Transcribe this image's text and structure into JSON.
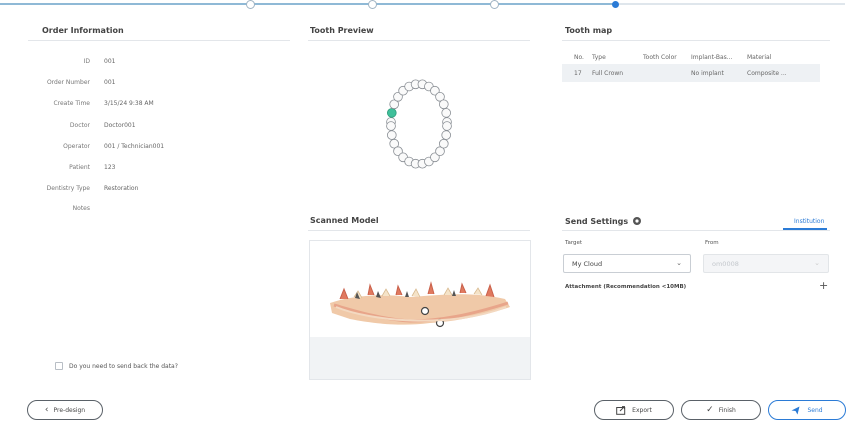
{
  "stepper": {
    "steps": [
      "",
      "",
      "",
      ""
    ],
    "active_index": 3
  },
  "order_info": {
    "title": "Order Information",
    "fields": [
      {
        "label": "ID",
        "value": "001"
      },
      {
        "label": "Order Number",
        "value": "001"
      },
      {
        "label": "Create Time",
        "value": "3/15/24 9:38 AM"
      },
      {
        "label": "Doctor",
        "value": "Doctor001"
      },
      {
        "label": "Operator",
        "value": "001 / Technician001"
      },
      {
        "label": "Patient",
        "value": "123"
      },
      {
        "label": "Dentistry Type",
        "value": "Restoration"
      },
      {
        "label": "Notes",
        "value": ""
      }
    ],
    "send_back_label": "Do you need to send back the data?"
  },
  "tooth_preview": {
    "title": "Tooth Preview",
    "selected_tooth": "17"
  },
  "scanned_model": {
    "title": "Scanned Model"
  },
  "tooth_map": {
    "title": "Tooth map",
    "columns": [
      "No.",
      "Type",
      "Tooth Color",
      "Implant-Bas...",
      "Material"
    ],
    "rows": [
      {
        "no": "17",
        "type": "Full Crown",
        "color": "",
        "implant": "No implant",
        "material": "Composite ..."
      }
    ]
  },
  "send_settings": {
    "title": "Send Settings",
    "tab": "Institution",
    "target_label": "Target",
    "target_value": "My Cloud",
    "from_label": "From",
    "from_value": "om0008",
    "attachment_label": "Attachment (Recommendation <10MB)",
    "add_icon": "plus-icon",
    "settings_icon": "gear-icon"
  },
  "buttons": {
    "pre_design": "Pre-design",
    "export": "Export",
    "finish": "Finish",
    "send": "Send"
  },
  "colors": {
    "accent": "#2b7bd6",
    "selected_tooth": "#3fbf9a"
  }
}
